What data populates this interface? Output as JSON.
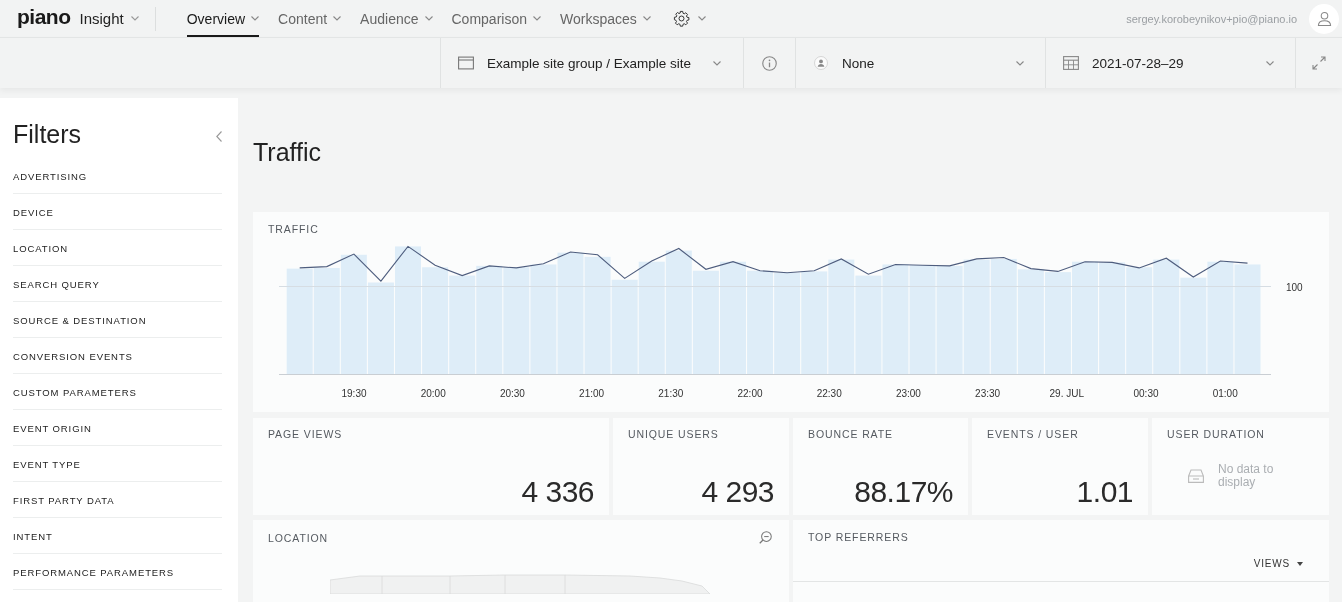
{
  "header": {
    "logo": "piano",
    "product": "Insight",
    "nav": [
      {
        "label": "Overview",
        "selected": true
      },
      {
        "label": "Content",
        "selected": false
      },
      {
        "label": "Audience",
        "selected": false
      },
      {
        "label": "Comparison",
        "selected": false
      },
      {
        "label": "Workspaces",
        "selected": false
      }
    ],
    "user_email": "sergey.korobeynikov+pio@piano.io"
  },
  "toolbar": {
    "site": "Example site group / Example site",
    "segment": "None",
    "date_range": "2021-07-28–29"
  },
  "filters": {
    "title": "Filters",
    "items": [
      "ADVERTISING",
      "DEVICE",
      "LOCATION",
      "SEARCH QUERY",
      "SOURCE & DESTINATION",
      "CONVERSION EVENTS",
      "CUSTOM PARAMETERS",
      "EVENT ORIGIN",
      "EVENT TYPE",
      "FIRST PARTY DATA",
      "INTENT",
      "PERFORMANCE PARAMETERS"
    ]
  },
  "page_title": "Traffic",
  "traffic_chart": {
    "title": "TRAFFIC",
    "y_tick": "100",
    "x_labels": [
      "19:30",
      "20:00",
      "20:30",
      "21:00",
      "21:30",
      "22:00",
      "22:30",
      "23:00",
      "23:30",
      "29. JUL",
      "00:30",
      "01:00"
    ]
  },
  "kpis": [
    {
      "kind": "metric",
      "label": "PAGE VIEWS",
      "value": "4 336"
    },
    {
      "kind": "metric",
      "label": "UNIQUE USERS",
      "value": "4 293"
    },
    {
      "kind": "metric",
      "label": "BOUNCE RATE",
      "value": "88.17%"
    },
    {
      "kind": "metric",
      "label": "EVENTS / USER",
      "value": "1.01"
    },
    {
      "kind": "empty",
      "label": "USER DURATION",
      "message": "No data to display"
    }
  ],
  "location": {
    "title": "LOCATION"
  },
  "top_referrers": {
    "title": "TOP REFERRERS",
    "sort_column": "VIEWS"
  }
}
